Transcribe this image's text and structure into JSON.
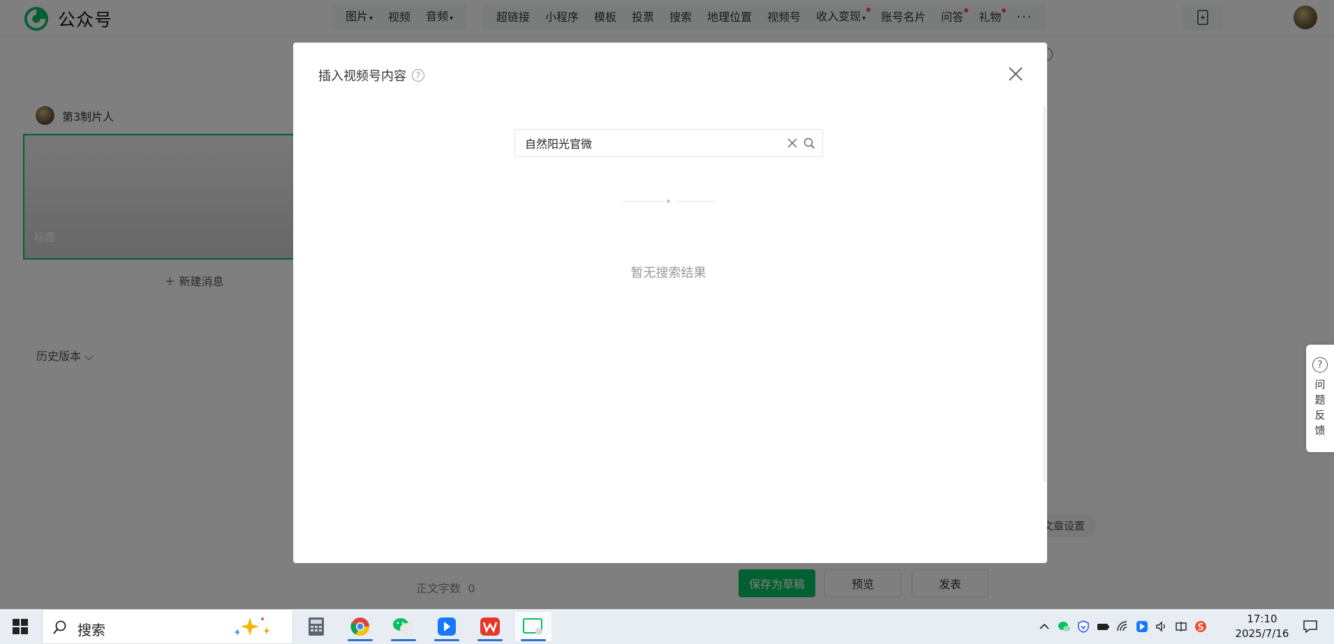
{
  "app": {
    "name": "公众号"
  },
  "toolbar": {
    "group1": [
      {
        "label": "图片",
        "dropdown": true
      },
      {
        "label": "视频",
        "dropdown": false
      },
      {
        "label": "音频",
        "dropdown": true
      }
    ],
    "group2": [
      {
        "label": "超链接",
        "dot": false,
        "dropdown": false
      },
      {
        "label": "小程序",
        "dot": false,
        "dropdown": false
      },
      {
        "label": "模板",
        "dot": false,
        "dropdown": false
      },
      {
        "label": "投票",
        "dot": false,
        "dropdown": false
      },
      {
        "label": "搜索",
        "dot": false,
        "dropdown": false
      },
      {
        "label": "地理位置",
        "dot": false,
        "dropdown": false
      },
      {
        "label": "视频号",
        "dot": false,
        "dropdown": false
      },
      {
        "label": "收入变现",
        "dot": true,
        "dropdown": true
      },
      {
        "label": "账号名片",
        "dot": false,
        "dropdown": false
      },
      {
        "label": "问答",
        "dot": true,
        "dropdown": false
      },
      {
        "label": "礼物",
        "dot": true,
        "dropdown": false
      }
    ],
    "more": "···"
  },
  "editor": {
    "author": "第3制片人",
    "cover_title_placeholder": "标题",
    "new_message": "新建消息",
    "history": "历史版本",
    "word_count_label": "正文字数",
    "word_count": "0",
    "save_draft": "保存为草稿",
    "preview": "预览",
    "publish": "发表",
    "article_settings": "文章设置"
  },
  "feedback": {
    "label": [
      "问",
      "题",
      "反",
      "馈"
    ],
    "icon": "?"
  },
  "dialog": {
    "title": "插入视频号内容",
    "help": "?",
    "search_value": "自然阳光官微",
    "empty": "暂无搜索结果"
  },
  "taskbar": {
    "search_label": "搜索",
    "time": "17:10",
    "date": "2025/7/16"
  },
  "colors": {
    "brand_green": "#07c160",
    "overlay": "rgba(0,0,0,0.5)",
    "badge_red": "#fa5151"
  }
}
